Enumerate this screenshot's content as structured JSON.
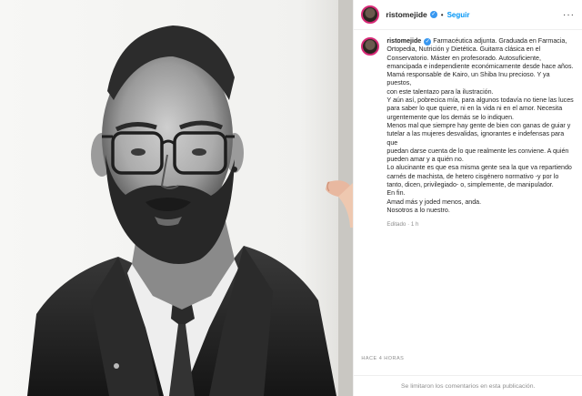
{
  "post": {
    "username": "ristomejide",
    "follow_label": "Seguir",
    "separator": "•",
    "verified_glyph": "✓",
    "more_glyph": "···",
    "caption_lines": [
      "Farmacéutica adjunta. Graduada en Farmacia,",
      "Ortopedia, Nutrición y Dietética. Guitarra clásica en el",
      "Conservatorio. Máster en profesorado. Autosuficiente,",
      "emancipada e independiente económicamente desde hace años.",
      "Mamá responsable de Kairo, un Shiba Inu precioso. Y ya puestos,",
      "con este talentazo para la ilustración.",
      "Y aún así, pobrecica mía, para algunos todavía no tiene las luces",
      "para saber lo que quiere, ni en la vida ni en el amor. Necesita",
      "urgentemente que los demás se lo indiquen.",
      "Menos mal que siempre hay gente de bien con ganas de guiar y",
      "tutelar a las mujeres desvalidas, ignorantes e indefensas para que",
      "puedan darse cuenta de lo que realmente les conviene. A quién",
      "pueden amar y a quién no.",
      "Lo alucinante es que esa misma gente sea la que va repartiendo",
      "carnés de machista, de hetero cisgénero normativo -y por lo",
      "tanto, dicen, privilegiado- o, simplemente, de manipulador.",
      "En fin.",
      "Amad más y joded menos, anda.",
      "Nosotros a lo nuestro."
    ],
    "edited": "Editado · 1 h",
    "time": "HACE 4 HORAS",
    "comments_disabled": "Se limitaron los comentarios en esta publicación."
  },
  "colors": {
    "link": "#0095f6",
    "verified": "#3897f0",
    "muted": "#8e8e8e"
  }
}
